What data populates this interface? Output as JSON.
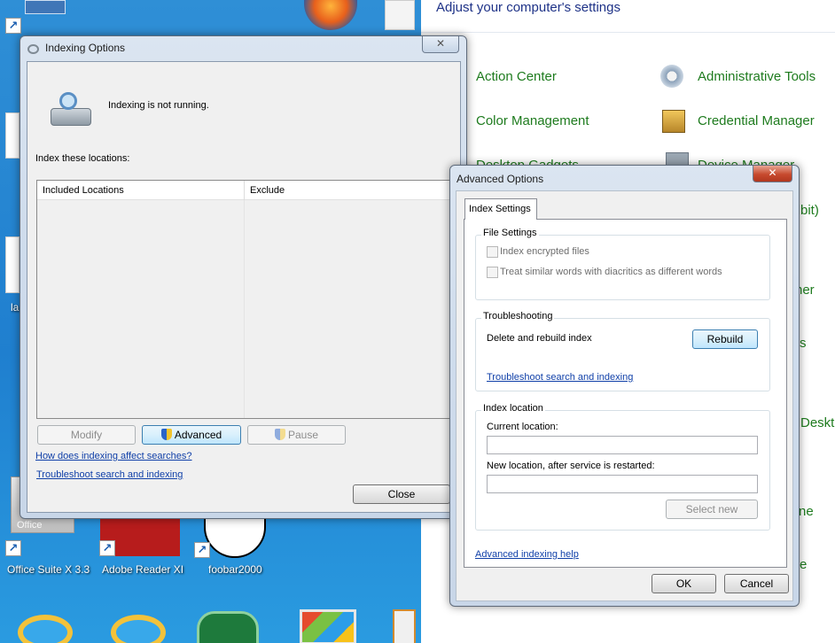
{
  "desktop": {
    "icons": [
      {
        "label": "Office Suite X 3.3"
      },
      {
        "label": "Adobe Reader XI"
      },
      {
        "label": "foobar2000"
      }
    ],
    "office_tile_text": "Office",
    "left_fragment": "la"
  },
  "control_panel": {
    "header": "Adjust your computer's settings",
    "left_items": [
      "Action Center",
      "Color Management",
      "Desktop Gadgets"
    ],
    "right_items": [
      "Administrative Tools",
      "Credential Manager",
      "Device Manager"
    ],
    "partial_right": [
      "bit)",
      "ner",
      "s",
      "Deskt",
      "ne",
      "e"
    ]
  },
  "indexing": {
    "title": "Indexing Options",
    "status": "Indexing is not running.",
    "locations_label": "Index these locations:",
    "columns": [
      "Included Locations",
      "Exclude"
    ],
    "buttons": {
      "modify": "Modify",
      "advanced": "Advanced",
      "pause": "Pause",
      "close": "Close"
    },
    "links": {
      "how": "How does indexing affect searches?",
      "troubleshoot": "Troubleshoot search and indexing"
    }
  },
  "advanced": {
    "title": "Advanced Options",
    "tab": "Index Settings",
    "file_settings": {
      "title": "File Settings",
      "options": [
        "Index encrypted files",
        "Treat similar words with diacritics as different words"
      ]
    },
    "troubleshooting": {
      "title": "Troubleshooting",
      "rebuild_label": "Delete and rebuild index",
      "rebuild_button": "Rebuild",
      "link": "Troubleshoot search and indexing"
    },
    "index_location": {
      "title": "Index location",
      "current_label": "Current location:",
      "current_value": "",
      "new_label": "New location, after service is restarted:",
      "new_value": "",
      "select_button": "Select new"
    },
    "help_link": "Advanced indexing help",
    "ok": "OK",
    "cancel": "Cancel"
  }
}
